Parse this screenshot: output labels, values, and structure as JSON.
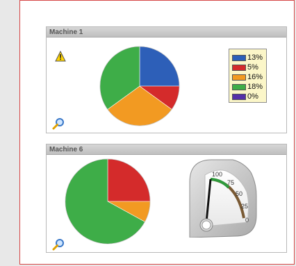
{
  "panels": [
    {
      "title": "Machine 1",
      "icons": {
        "warning": "warning-icon",
        "zoom": "magnifier-icon"
      },
      "chart_data": {
        "type": "pie",
        "slices": [
          {
            "label": "13%",
            "value": 25,
            "color": "#2d5fb8"
          },
          {
            "label": "5%",
            "value": 10,
            "color": "#d42b2b"
          },
          {
            "label": "16%",
            "value": 30,
            "color": "#f29a22"
          },
          {
            "label": "18%",
            "value": 35,
            "color": "#3ead48"
          },
          {
            "label": "0%",
            "value": 0,
            "color": "#5530a8"
          }
        ]
      },
      "legend": [
        {
          "label": "13%",
          "color": "#2d5fb8"
        },
        {
          "label": "5%",
          "color": "#d42b2b"
        },
        {
          "label": "16%",
          "color": "#f29a22"
        },
        {
          "label": "18%",
          "color": "#3ead48"
        },
        {
          "label": "0%",
          "color": "#5530a8"
        }
      ]
    },
    {
      "title": "Machine 6",
      "icons": {
        "zoom": "magnifier-icon"
      },
      "chart_data": {
        "type": "pie",
        "slices": [
          {
            "value": 25,
            "color": "#d42b2b"
          },
          {
            "value": 8,
            "color": "#f29a22"
          },
          {
            "value": 67,
            "color": "#3ead48"
          }
        ]
      },
      "gauge": {
        "ticks": [
          "100",
          "75",
          "50",
          "25",
          "0"
        ],
        "value": 100,
        "min": 0,
        "max": 100
      }
    }
  ]
}
